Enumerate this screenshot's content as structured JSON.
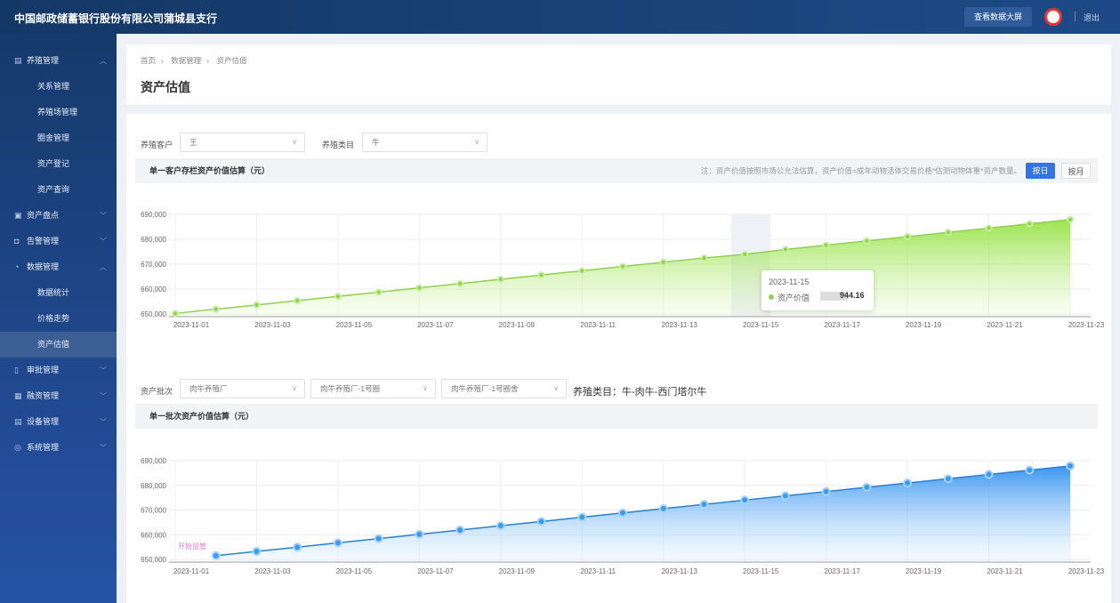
{
  "header": {
    "title": "中国邮政储蓄银行股份有限公司蒲城县支行",
    "bigscreen_label": "查看数据大屏",
    "logout_label": "退出"
  },
  "sidebar": {
    "items": [
      {
        "label": "养殖管理",
        "type": "parent",
        "icon": "building-icon",
        "expanded": true
      },
      {
        "label": "关系管理",
        "type": "child"
      },
      {
        "label": "养殖场管理",
        "type": "child"
      },
      {
        "label": "圈舍管理",
        "type": "child"
      },
      {
        "label": "资产登记",
        "type": "child"
      },
      {
        "label": "资产查询",
        "type": "child"
      },
      {
        "label": "资产盘点",
        "type": "parent",
        "icon": "box-icon"
      },
      {
        "label": "告警管理",
        "type": "parent",
        "icon": "alarm-icon"
      },
      {
        "label": "数据管理",
        "type": "parent",
        "icon": "pie-icon",
        "expanded": true
      },
      {
        "label": "数据统计",
        "type": "child"
      },
      {
        "label": "价格走势",
        "type": "child"
      },
      {
        "label": "资产估值",
        "type": "child",
        "active": true
      },
      {
        "label": "审批管理",
        "type": "parent",
        "icon": "document-icon"
      },
      {
        "label": "融资管理",
        "type": "parent",
        "icon": "finance-icon"
      },
      {
        "label": "设备管理",
        "type": "parent",
        "icon": "device-icon"
      },
      {
        "label": "系统管理",
        "type": "parent",
        "icon": "settings-icon"
      }
    ]
  },
  "breadcrumb": [
    "首页",
    "数据管理",
    "资产估值"
  ],
  "page_title": "资产估值",
  "filters1": {
    "customer_label": "养殖客户",
    "customer_value": "王",
    "category_label": "养殖类目",
    "category_value": "牛"
  },
  "section1": {
    "title": "单一客户存栏资产价值估算（元）",
    "note": "注：资产价值按照市场公允法估算，资产价值=成年动物活体交易价格*估测动物体重*资产数量。",
    "btn_day": "按日",
    "btn_month": "按月"
  },
  "filters2": {
    "batch_label": "资产批次",
    "batch1": "肉牛养殖厂",
    "batch2": "肉牛养殖厂-1号圈",
    "batch3": "肉牛养殖厂-1号圈舍",
    "category_text": "养殖类目：牛-肉牛-西门塔尔牛"
  },
  "section2": {
    "title": "单一批次资产价值估算（元）"
  },
  "tooltip": {
    "date": "2023-11-15",
    "series": "资产价值",
    "value": "944.16"
  },
  "colors": {
    "green": "#8fd14f",
    "blue": "#3a9cf0",
    "primary": "#2f74e8"
  },
  "chart_data": [
    {
      "type": "area",
      "x": [
        "2023-11-01",
        "2023-11-02",
        "2023-11-03",
        "2023-11-04",
        "2023-11-05",
        "2023-11-06",
        "2023-11-07",
        "2023-11-08",
        "2023-11-09",
        "2023-11-10",
        "2023-11-11",
        "2023-11-12",
        "2023-11-13",
        "2023-11-14",
        "2023-11-15",
        "2023-11-16",
        "2023-11-17",
        "2023-11-18",
        "2023-11-19",
        "2023-11-20",
        "2023-11-21",
        "2023-11-22",
        "2023-11-23"
      ],
      "x_ticks": [
        "2023-11-01",
        "2023-11-03",
        "2023-11-05",
        "2023-11-07",
        "2023-11-09",
        "2023-11-11",
        "2023-11-13",
        "2023-11-15",
        "2023-11-17",
        "2023-11-19",
        "2023-11-21",
        "2023-11-23"
      ],
      "y_ticks": [
        "650,000",
        "660,000",
        "670,000",
        "680,000",
        "690,000"
      ],
      "ylim": [
        650000,
        690000
      ],
      "grid": true,
      "series": [
        {
          "name": "资产价值",
          "color": "#8fd14f",
          "values": [
            650200,
            651914,
            653627,
            655341,
            657054,
            658768,
            660482,
            662195,
            663909,
            665622,
            667336,
            669050,
            670763,
            672477,
            673944.16,
            675904,
            677618,
            679331,
            681045,
            682758,
            684472,
            686186,
            687899
          ]
        }
      ]
    },
    {
      "type": "area",
      "x": [
        "2023-11-01",
        "2023-11-02",
        "2023-11-03",
        "2023-11-04",
        "2023-11-05",
        "2023-11-06",
        "2023-11-07",
        "2023-11-08",
        "2023-11-09",
        "2023-11-10",
        "2023-11-11",
        "2023-11-12",
        "2023-11-13",
        "2023-11-14",
        "2023-11-15",
        "2023-11-16",
        "2023-11-17",
        "2023-11-18",
        "2023-11-19",
        "2023-11-20",
        "2023-11-21",
        "2023-11-22",
        "2023-11-23"
      ],
      "x_ticks": [
        "2023-11-01",
        "2023-11-03",
        "2023-11-05",
        "2023-11-07",
        "2023-11-09",
        "2023-11-11",
        "2023-11-13",
        "2023-11-15",
        "2023-11-17",
        "2023-11-19",
        "2023-11-21",
        "2023-11-23"
      ],
      "y_ticks": [
        "650,000",
        "660,000",
        "670,000",
        "680,000",
        "690,000"
      ],
      "ylim": [
        650000,
        690000
      ],
      "grid": true,
      "annotation": "开始监管",
      "series": [
        {
          "color": "#3a9cf0",
          "values": [
            null,
            651500,
            653233,
            654967,
            656700,
            658433,
            660167,
            661900,
            663633,
            665367,
            667100,
            668833,
            670567,
            672300,
            674033,
            675767,
            677500,
            679233,
            680967,
            682700,
            684433,
            686167,
            687900
          ]
        }
      ]
    }
  ]
}
